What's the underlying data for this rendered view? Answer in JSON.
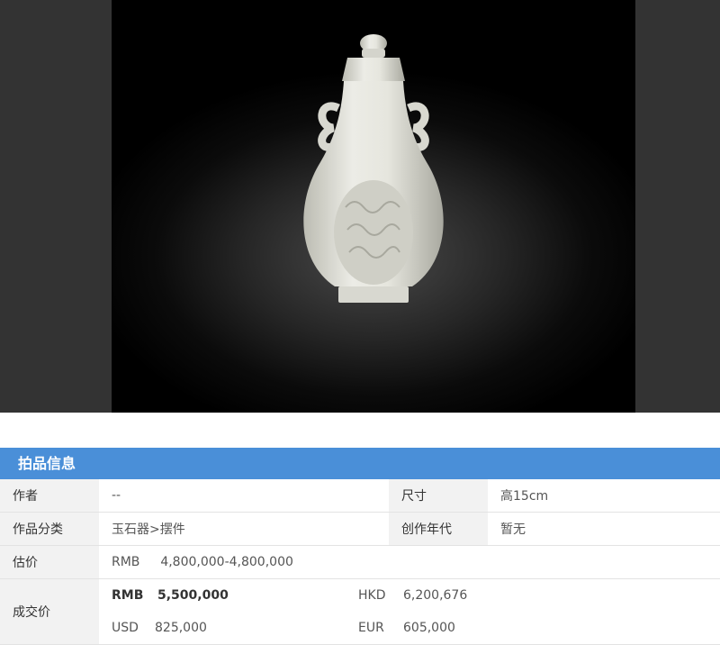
{
  "section": {
    "title": "拍品信息"
  },
  "info": {
    "author_label": "作者",
    "author_value": "--",
    "size_label": "尺寸",
    "size_value": "高15cm",
    "category_label": "作品分类",
    "category_value": "玉石器>摆件",
    "era_label": "创作年代",
    "era_value": "暂无",
    "estimate_label": "估价",
    "estimate_currency": "RMB",
    "estimate_value": "4,800,000-4,800,000",
    "price_label": "成交价",
    "prices": {
      "rmb_cur": "RMB",
      "rmb_val": "5,500,000",
      "hkd_cur": "HKD",
      "hkd_val": "6,200,676",
      "usd_cur": "USD",
      "usd_val": "825,000",
      "eur_cur": "EUR",
      "eur_val": "605,000"
    }
  },
  "colors": {
    "header_blue": "#4a8fd8",
    "estimate_red": "#e02020"
  }
}
